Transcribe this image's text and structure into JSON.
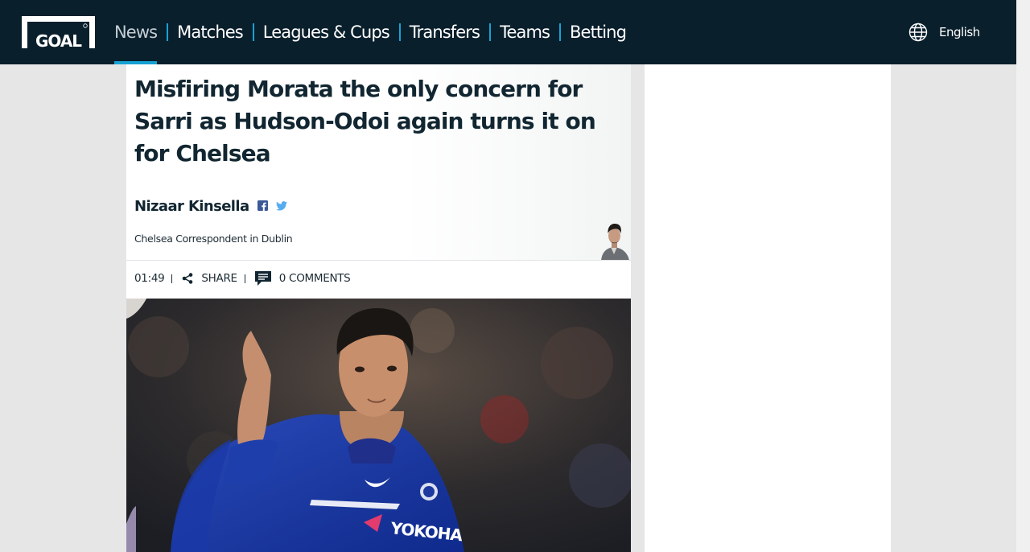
{
  "brand": {
    "logo_text": "GOAL",
    "accent_color": "#17a2d3",
    "topbar_color": "#091f2c"
  },
  "nav": {
    "items": [
      {
        "label": "News",
        "active": true
      },
      {
        "label": "Matches"
      },
      {
        "label": "Leagues & Cups"
      },
      {
        "label": "Transfers"
      },
      {
        "label": "Teams"
      },
      {
        "label": "Betting"
      }
    ]
  },
  "language": {
    "icon": "globe-icon",
    "label": "English"
  },
  "article": {
    "headline": "Misfiring Morata the only concern for Sarri as Hudson-Odoi again turns it on for Chelsea",
    "author": {
      "name": "Nizaar Kinsella",
      "role": "Chelsea Correspondent in Dublin",
      "social_icons": [
        "facebook-icon",
        "twitter-icon"
      ]
    },
    "meta": {
      "time": "01:49",
      "share_label": "SHARE",
      "comments_label": "0 COMMENTS"
    },
    "hero_image": {
      "subject": "footballer-in-blue-kit",
      "sponsor_text": "YOKOHA"
    }
  }
}
